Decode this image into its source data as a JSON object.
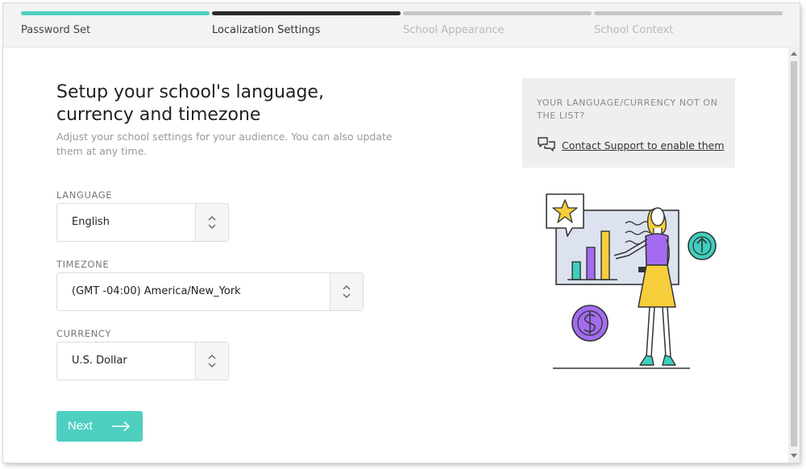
{
  "stepper": {
    "steps": [
      {
        "label": "Password Set",
        "state": "complete"
      },
      {
        "label": "Localization Settings",
        "state": "current"
      },
      {
        "label": "School Appearance",
        "state": "upcoming"
      },
      {
        "label": "School Context",
        "state": "upcoming"
      }
    ]
  },
  "main": {
    "title": "Setup your school's language, currency and timezone",
    "subtitle": "Adjust your school settings for your audience. You can also update them at any time.",
    "language": {
      "label": "LANGUAGE",
      "value": "English"
    },
    "timezone": {
      "label": "TIMEZONE",
      "value": "(GMT -04:00) America/New_York"
    },
    "currency": {
      "label": "CURRENCY",
      "value": "U.S. Dollar"
    },
    "next_label": "Next"
  },
  "support": {
    "question": "YOUR LANGUAGE/CURRENCY NOT ON THE LIST?",
    "link_text": "Contact Support to enable them"
  },
  "colors": {
    "accent": "#4ecfc0",
    "step_complete": "#4ecfc0",
    "step_current": "#2b2b2b",
    "step_upcoming": "#c6c6c6",
    "label_complete": "#444444",
    "label_current": "#333333",
    "label_upcoming": "#b9b9b9"
  },
  "icons": {
    "next": "arrow-right-icon",
    "select_handle": "chevron-up-down-icon",
    "support": "chat-bubbles-icon"
  }
}
